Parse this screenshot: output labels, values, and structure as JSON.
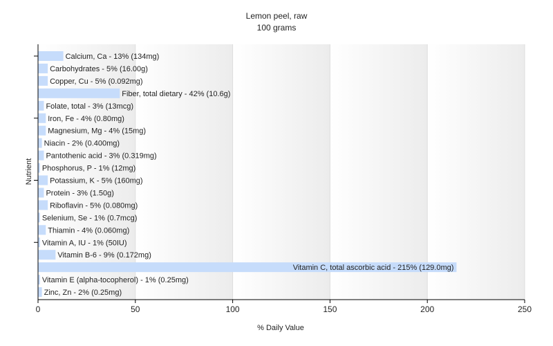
{
  "chart_data": {
    "type": "bar",
    "orientation": "horizontal",
    "title": "Lemon peel, raw",
    "subtitle": "100 grams",
    "xlabel": "% Daily Value",
    "ylabel": "Nutrient",
    "xlim": [
      0,
      250
    ],
    "xticks": [
      "0",
      "50",
      "100",
      "150",
      "200",
      "250"
    ],
    "grid": true,
    "bar_color": "#c6dcfb",
    "categories": [
      "Calcium, Ca",
      "Carbohydrates",
      "Copper, Cu",
      "Fiber, total dietary",
      "Folate, total",
      "Iron, Fe",
      "Magnesium, Mg",
      "Niacin",
      "Pantothenic acid",
      "Phosphorus, P",
      "Potassium, K",
      "Protein",
      "Riboflavin",
      "Selenium, Se",
      "Thiamin",
      "Vitamin A, IU",
      "Vitamin B-6",
      "Vitamin C, total ascorbic acid",
      "Vitamin E (alpha-tocopherol)",
      "Zinc, Zn"
    ],
    "values": [
      13,
      5,
      5,
      42,
      3,
      4,
      4,
      2,
      3,
      1,
      5,
      3,
      5,
      1,
      4,
      1,
      9,
      215,
      1,
      2
    ],
    "labels": [
      "Calcium, Ca - 13% (134mg)",
      "Carbohydrates - 5% (16.00g)",
      "Copper, Cu - 5% (0.092mg)",
      "Fiber, total dietary - 42% (10.6g)",
      "Folate, total - 3% (13mcg)",
      "Iron, Fe - 4% (0.80mg)",
      "Magnesium, Mg - 4% (15mg)",
      "Niacin - 2% (0.400mg)",
      "Pantothenic acid - 3% (0.319mg)",
      "Phosphorus, P - 1% (12mg)",
      "Potassium, K - 5% (160mg)",
      "Protein - 3% (1.50g)",
      "Riboflavin - 5% (0.080mg)",
      "Selenium, Se - 1% (0.7mcg)",
      "Thiamin - 4% (0.060mg)",
      "Vitamin A, IU - 1% (50IU)",
      "Vitamin B-6 - 9% (0.172mg)",
      "Vitamin C, total ascorbic acid - 215% (129.0mg)",
      "Vitamin E (alpha-tocopherol) - 1% (0.25mg)",
      "Zinc, Zn - 2% (0.25mg)"
    ]
  }
}
